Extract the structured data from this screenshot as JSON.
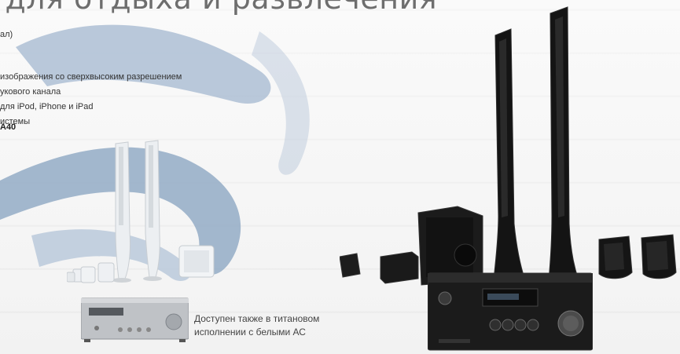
{
  "headline": "е для отдыха и развлечения",
  "features": [
    "ал)",
    "изображения со сверхвысоким разрешением",
    "укового канала",
    " для iPod, iPhone и iPad",
    "истемы"
  ],
  "model": "A40",
  "caption_line1": "Доступен также в титановом",
  "caption_line2": "исполнении с белыми АС",
  "colors": {
    "accent_stroke": "#9eb3cc",
    "speaker_black": "#151515",
    "speaker_white": "#e9ecef",
    "receiver_silver": "#b9bcc0"
  }
}
